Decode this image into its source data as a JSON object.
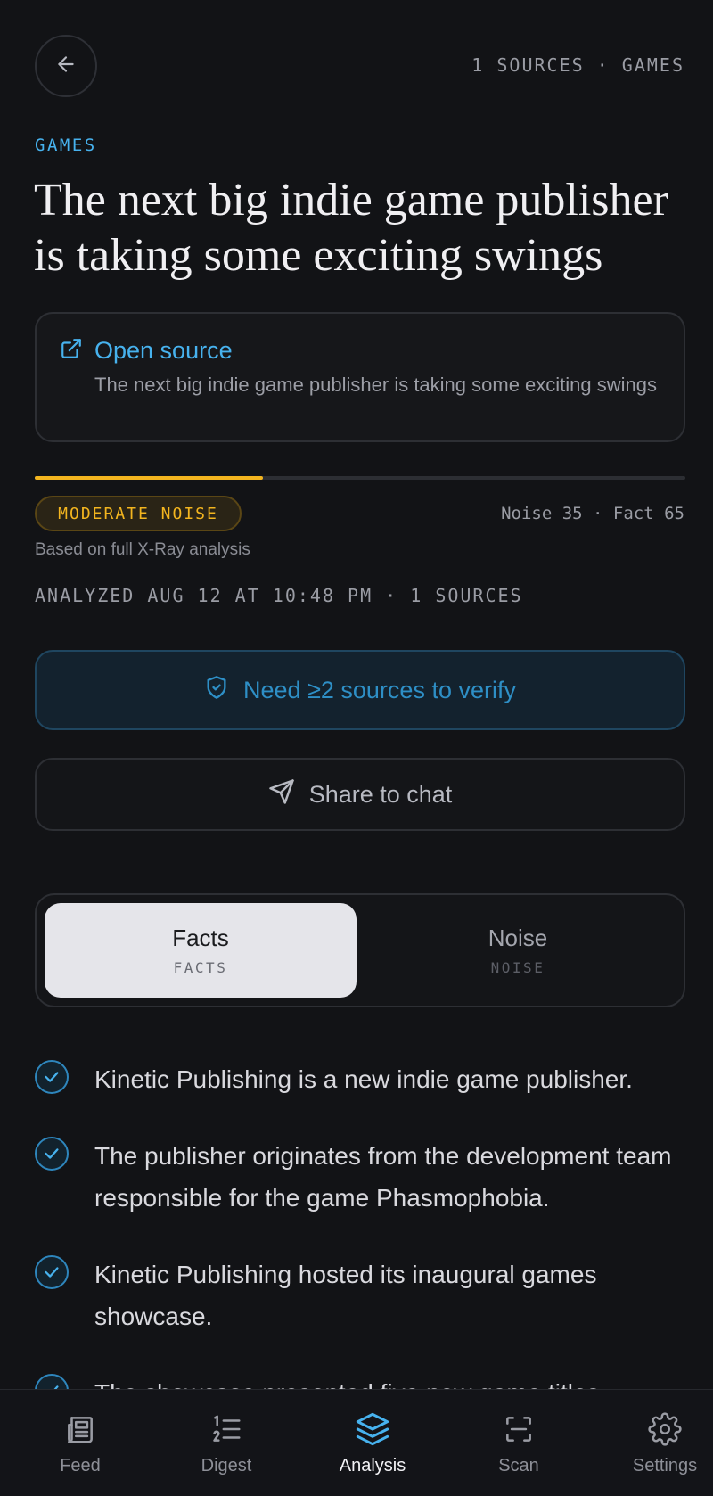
{
  "header": {
    "meta": "1 SOURCES · GAMES"
  },
  "article": {
    "category": "GAMES",
    "title": "The next big indie game publisher is taking some exciting swings"
  },
  "source": {
    "link_label": "Open source",
    "description": "The next big indie game publisher is taking some exciting swings"
  },
  "noise": {
    "level_label": "MODERATE NOISE",
    "noise_percent": 35,
    "score_text": "Noise 35 · Fact 65",
    "basis": "Based on full X-Ray analysis",
    "analyzed": "ANALYZED AUG 12 AT 10:48 PM · 1 SOURCES"
  },
  "actions": {
    "verify_label": "Need ≥2 sources to verify",
    "share_label": "Share to chat"
  },
  "tabs": [
    {
      "label": "Facts",
      "sub": "FACTS",
      "active": true
    },
    {
      "label": "Noise",
      "sub": "NOISE",
      "active": false
    }
  ],
  "facts": [
    "Kinetic Publishing is a new indie game publisher.",
    "The publisher originates from the development team responsible for the game Phasmophobia.",
    "Kinetic Publishing hosted its inaugural games showcase.",
    "The showcase presented five new game titles."
  ],
  "nav": [
    {
      "label": "Feed",
      "icon": "newspaper-icon",
      "active": false
    },
    {
      "label": "Digest",
      "icon": "numbered-list-icon",
      "active": false
    },
    {
      "label": "Analysis",
      "icon": "layers-icon",
      "active": true
    },
    {
      "label": "Scan",
      "icon": "scan-icon",
      "active": false
    },
    {
      "label": "Settings",
      "icon": "gear-icon",
      "active": false
    }
  ],
  "colors": {
    "accent": "#47b2ee",
    "noise_warning": "#f3b51f",
    "background": "#121316"
  }
}
